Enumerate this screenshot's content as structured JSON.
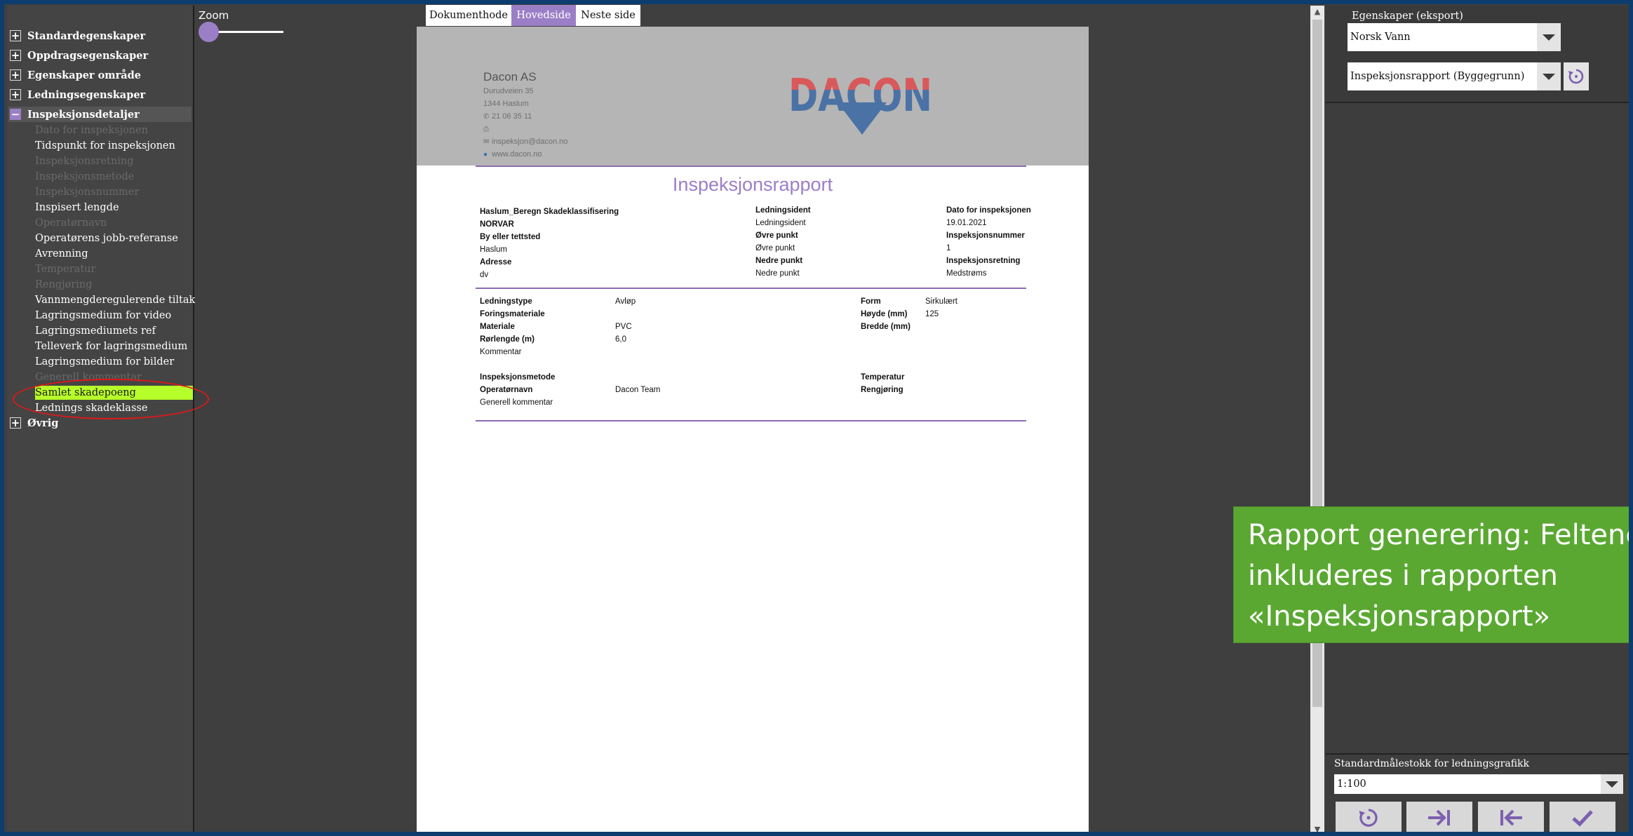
{
  "tree": {
    "groups": [
      {
        "label": "Standardegenskaper",
        "expanded": false
      },
      {
        "label": "Oppdragsegenskaper",
        "expanded": false
      },
      {
        "label": "Egenskaper område",
        "expanded": false
      },
      {
        "label": "Ledningsegenskaper",
        "expanded": false
      },
      {
        "label": "Inspeksjonsdetaljer",
        "expanded": true
      }
    ],
    "items": [
      {
        "label": "Dato for inspeksjonen",
        "enabled": false
      },
      {
        "label": "Tidspunkt for inspeksjonen",
        "enabled": true
      },
      {
        "label": "Inspeksjonsretning",
        "enabled": false
      },
      {
        "label": "Inspeksjonsmetode",
        "enabled": false
      },
      {
        "label": "Inspeksjonsnummer",
        "enabled": false
      },
      {
        "label": "Inspisert lengde",
        "enabled": true
      },
      {
        "label": "Operatørnavn",
        "enabled": false
      },
      {
        "label": "Operatørens jobb-referanse",
        "enabled": true
      },
      {
        "label": "Avrenning",
        "enabled": true
      },
      {
        "label": "Temperatur",
        "enabled": false
      },
      {
        "label": "Rengjøring",
        "enabled": false
      },
      {
        "label": "Vannmengderegulerende tiltak",
        "enabled": true
      },
      {
        "label": "Lagringsmedium for video",
        "enabled": true
      },
      {
        "label": "Lagringsmediumets ref",
        "enabled": true
      },
      {
        "label": "Telleverk for lagringsmedium",
        "enabled": true
      },
      {
        "label": "Lagringsmedium for bilder",
        "enabled": true
      },
      {
        "label": "Generell kommentar",
        "enabled": false
      },
      {
        "label": "Samlet skadepoeng",
        "enabled": true,
        "highlighted": true
      },
      {
        "label": "Lednings skadeklasse",
        "enabled": true
      }
    ],
    "last_group": {
      "label": "Øvrig",
      "expanded": false
    }
  },
  "zoom": {
    "label": "Zoom",
    "level": 0
  },
  "tabs": [
    {
      "label": "Dokumenthode",
      "selected": false
    },
    {
      "label": "Hovedside",
      "selected": true
    },
    {
      "label": "Neste side",
      "selected": false
    }
  ],
  "document": {
    "company": {
      "name": "Dacon AS",
      "street": "Durudveien 35",
      "city": "1344 Haslum",
      "phone": "21 06 35 11",
      "fax": "",
      "email": "inspeksjon@dacon.no",
      "web": "www.dacon.no",
      "logo_text": "DACON"
    },
    "title": "Inspeksjonsrapport",
    "block1": {
      "col1": [
        "Haslum_Beregn Skadeklassifisering",
        "NORVAR",
        "By eller tettsted",
        "Haslum",
        "Adresse",
        "dv"
      ],
      "col2": [
        "Ledningsident",
        "Ledningsident",
        "Øvre punkt",
        "Øvre punkt",
        "Nedre punkt",
        "Nedre punkt"
      ],
      "col3": [
        "Dato for inspeksjonen",
        "19.01.2021",
        "Inspeksjonsnummer",
        "1",
        "Inspeksjonsretning",
        "Medstrøms"
      ]
    },
    "block2": {
      "labels": [
        "Ledningstype",
        "Foringsmateriale",
        "Materiale",
        "Rørlengde (m)",
        "Kommentar"
      ],
      "values": [
        "Avløp",
        "",
        "PVC",
        "6,0",
        ""
      ],
      "labels2": [
        "Form",
        "Høyde (mm)",
        "Bredde (mm)"
      ],
      "values2": [
        "Sirkulært",
        "125",
        ""
      ]
    },
    "block3": {
      "labels": [
        "Inspeksjonsmetode",
        "Operatørnavn",
        "Generell kommentar"
      ],
      "values": [
        "",
        "Dacon Team",
        ""
      ],
      "labels2": [
        "Temperatur",
        "Rengjøring"
      ]
    }
  },
  "right_panel": {
    "label": "Egenskaper (eksport)",
    "profile": "Norsk Vann",
    "report": "Inspeksjonsrapport (Byggegrunn)",
    "scale_label": "Standardmålestokk for ledningsgrafikk",
    "scale_value": "1:100"
  },
  "callout": {
    "line1": "Rapport generering: Feltene",
    "line2": "inkluderes i rapporten",
    "line3": "«Inspeksjonsrapport»"
  },
  "colors": {
    "accent": "#9b7fc6",
    "highlight": "#b7ff2a",
    "callout": "#5aa832",
    "circle": "#e01818"
  },
  "icons": [
    "expand-icon",
    "collapse-icon",
    "reset-icon",
    "last-page-icon",
    "first-page-icon",
    "check-icon",
    "dropdown-icon",
    "phone-icon",
    "fax-icon",
    "email-icon",
    "globe-icon"
  ]
}
